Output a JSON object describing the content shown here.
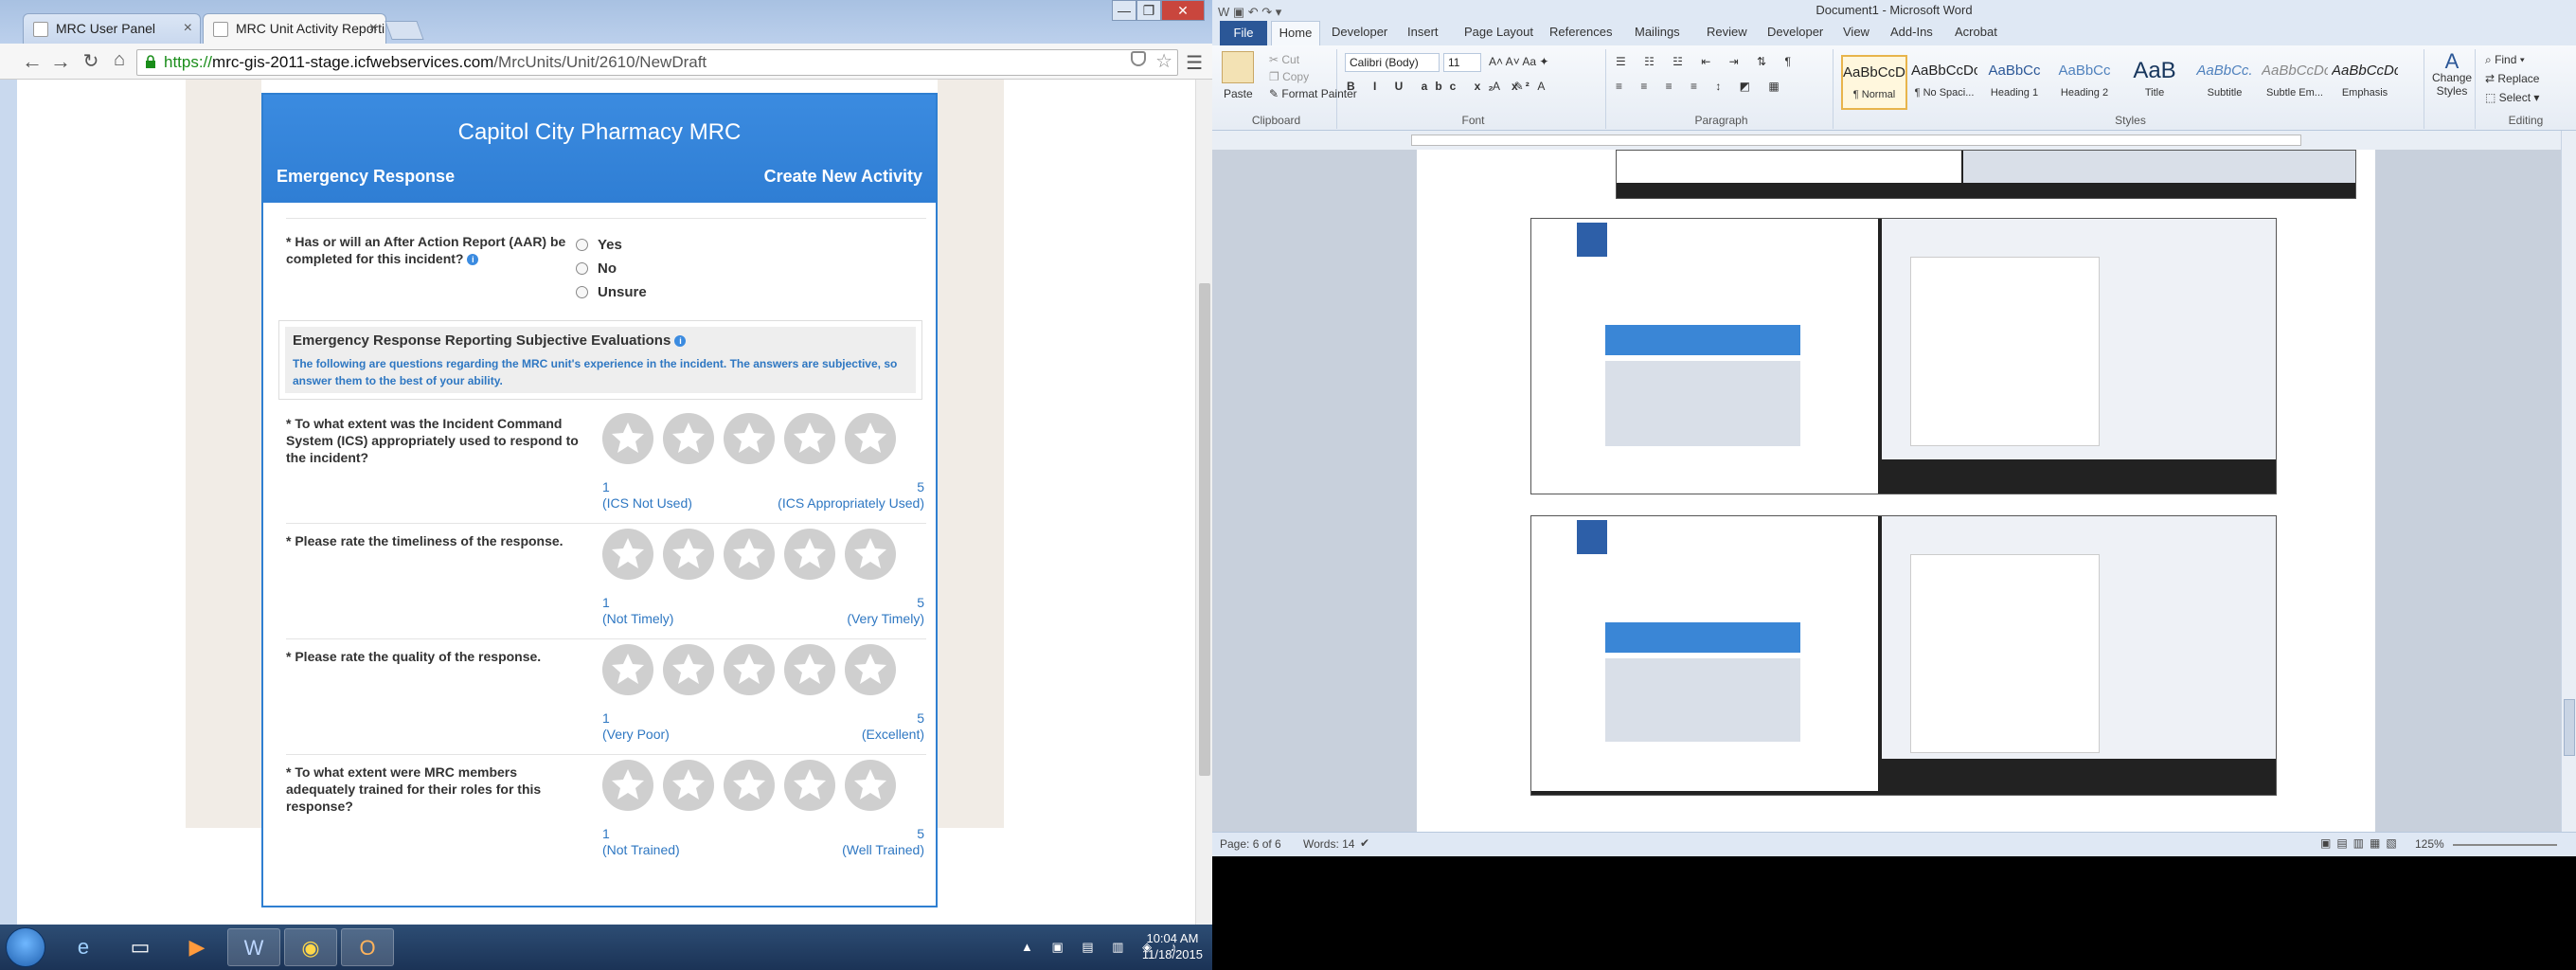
{
  "browser": {
    "tabs": [
      {
        "label": "MRC User Panel"
      },
      {
        "label": "MRC Unit Activity Reporti"
      }
    ],
    "url": {
      "scheme": "https://",
      "host": "mrc-gis-2011-stage.icfwebservices.com",
      "path": "/MrcUnits/Unit/2610/NewDraft"
    },
    "window_buttons": [
      "—",
      "❐",
      "✕"
    ]
  },
  "form": {
    "unit_name": "Capitol City Pharmacy MRC",
    "section": "Emergency Response",
    "action": "Create New Activity",
    "aar_question": "* Has or will an After Action Report (AAR) be completed for this incident?",
    "aar_options": [
      "Yes",
      "No",
      "Unsure"
    ],
    "eval_title": "Emergency Response Reporting Subjective Evaluations",
    "eval_desc": "The following are questions regarding the MRC unit's experience in the incident. The answers are subjective, so answer them to the best of your ability.",
    "questions": [
      {
        "text": "* To what extent was the Incident Command System (ICS) appropriately used to respond to the incident?",
        "low": "1",
        "high": "5",
        "low_label": "(ICS Not Used)",
        "high_label": "(ICS Appropriately Used)",
        "rating": 0
      },
      {
        "text": "* Please rate the timeliness of the response.",
        "low": "1",
        "high": "5",
        "low_label": "(Not Timely)",
        "high_label": "(Very Timely)",
        "rating": 0
      },
      {
        "text": "* Please rate the quality of the response.",
        "low": "1",
        "high": "5",
        "low_label": "(Very Poor)",
        "high_label": "(Excellent)",
        "rating": 0
      },
      {
        "text": "* To what extent were MRC members adequately trained for their roles for this response?",
        "low": "1",
        "high": "5",
        "low_label": "(Not Trained)",
        "high_label": "(Well Trained)",
        "rating": 0
      }
    ]
  },
  "taskbar": {
    "time": "10:04 AM",
    "date": "11/18/2015"
  },
  "word": {
    "title": "Document1 - Microsoft Word",
    "tabs": [
      "File",
      "Home",
      "Developer",
      "Insert",
      "Page Layout",
      "References",
      "Mailings",
      "Review",
      "Developer",
      "View",
      "Add-Ins",
      "Acrobat"
    ],
    "clipboard": {
      "paste": "Paste",
      "cut": "Cut",
      "copy": "Copy",
      "format_painter": "Format Painter",
      "label": "Clipboard"
    },
    "font": {
      "name": "Calibri (Body)",
      "size": "11",
      "label": "Font"
    },
    "paragraph_label": "Paragraph",
    "styles_label": "Styles",
    "styles": [
      {
        "preview": "AaBbCcDc",
        "name": "¶ Normal"
      },
      {
        "preview": "AaBbCcDc",
        "name": "¶ No Spaci..."
      },
      {
        "preview": "AaBbCc",
        "name": "Heading 1"
      },
      {
        "preview": "AaBbCc",
        "name": "Heading 2"
      },
      {
        "preview": "AaB",
        "name": "Title"
      },
      {
        "preview": "AaBbCc.",
        "name": "Subtitle"
      },
      {
        "preview": "AaBbCcDc",
        "name": "Subtle Em..."
      },
      {
        "preview": "AaBbCcDc",
        "name": "Emphasis"
      }
    ],
    "change_styles": "Change Styles",
    "editing": {
      "find": "Find",
      "replace": "Replace",
      "select": "Select",
      "label": "Editing"
    },
    "status": {
      "page": "Page: 6 of 6",
      "words": "Words: 14",
      "zoom": "125%"
    }
  }
}
